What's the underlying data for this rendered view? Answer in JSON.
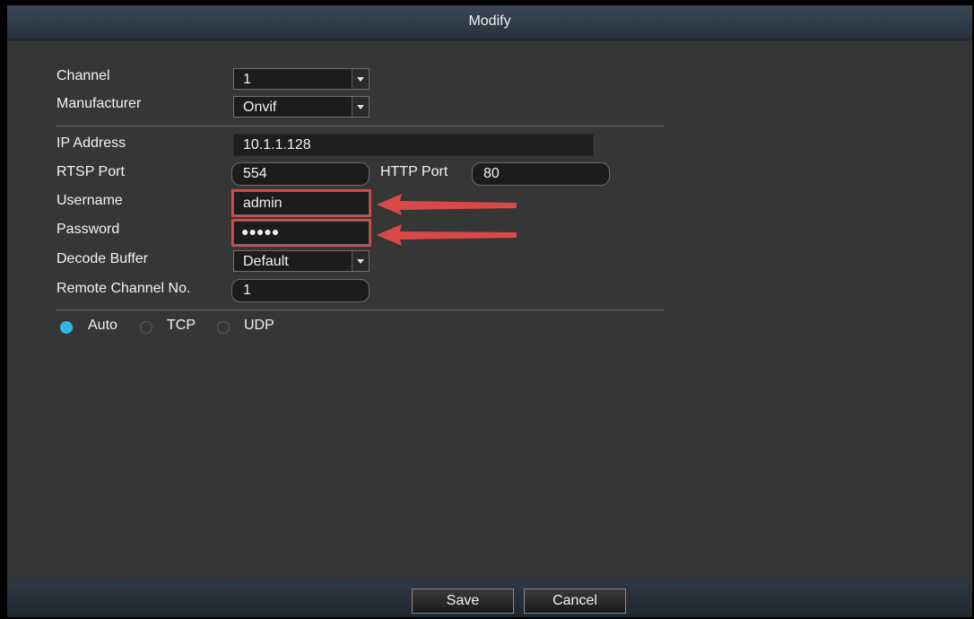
{
  "dialog": {
    "title": "Modify"
  },
  "form": {
    "channel": {
      "label": "Channel",
      "value": "1"
    },
    "manufacturer": {
      "label": "Manufacturer",
      "value": "Onvif"
    },
    "ip_address": {
      "label": "IP Address",
      "value": "10.1.1.128"
    },
    "rtsp_port": {
      "label": "RTSP Port",
      "value": "554"
    },
    "http_port": {
      "label": "HTTP Port",
      "value": "80"
    },
    "username": {
      "label": "Username",
      "value": "admin"
    },
    "password": {
      "label": "Password",
      "value": "●●●●●"
    },
    "decode_buffer": {
      "label": "Decode Buffer",
      "value": "Default"
    },
    "remote_channel": {
      "label": "Remote Channel No.",
      "value": "1"
    }
  },
  "protocol": {
    "options": [
      "Auto",
      "TCP",
      "UDP"
    ],
    "selected": "Auto"
  },
  "buttons": {
    "save": "Save",
    "cancel": "Cancel"
  },
  "colors": {
    "accent": "#2fb7e8",
    "annotation": "#d94a46",
    "background": "#363636"
  }
}
